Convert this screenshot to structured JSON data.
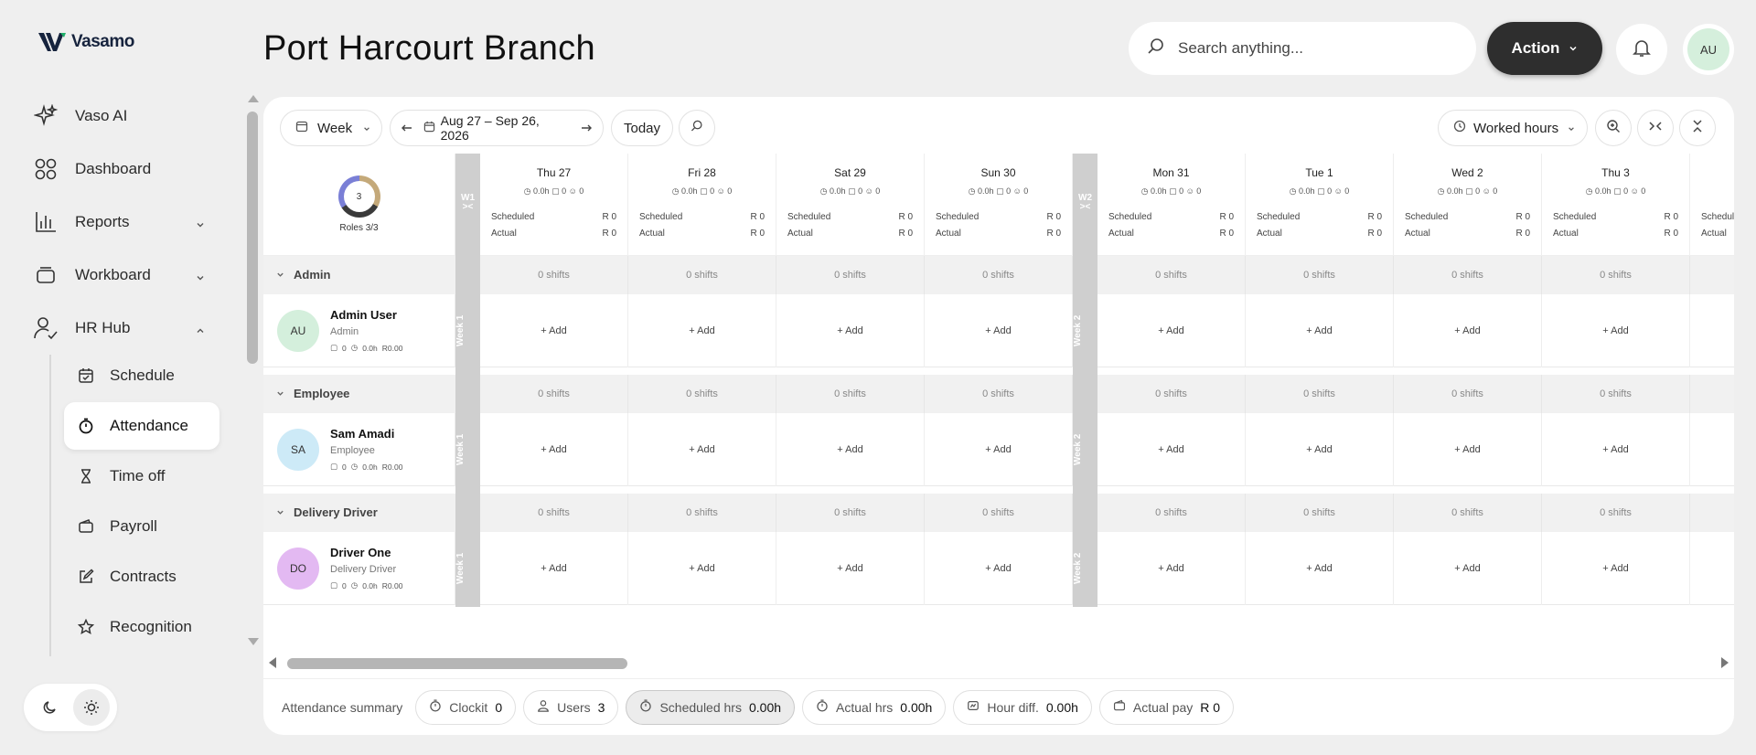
{
  "brand": {
    "name": "Vasamo"
  },
  "page": {
    "title": "Port Harcourt Branch"
  },
  "search": {
    "placeholder": "Search anything..."
  },
  "header": {
    "action_label": "Action",
    "avatar_initials": "AU"
  },
  "sidebar": {
    "items": [
      {
        "label": "Vaso AI",
        "icon": "sparkle-icon"
      },
      {
        "label": "Dashboard",
        "icon": "grid-icon"
      },
      {
        "label": "Reports",
        "icon": "bar-chart-icon",
        "expandable": true
      },
      {
        "label": "Workboard",
        "icon": "board-icon",
        "expandable": true
      },
      {
        "label": "HR Hub",
        "icon": "user-check-icon",
        "expanded": true
      }
    ],
    "subitems": [
      {
        "label": "Schedule",
        "icon": "calendar-check-icon"
      },
      {
        "label": "Attendance",
        "icon": "stopwatch-icon",
        "active": true
      },
      {
        "label": "Time off",
        "icon": "hourglass-icon"
      },
      {
        "label": "Payroll",
        "icon": "wallet-icon"
      },
      {
        "label": "Contracts",
        "icon": "edit-doc-icon"
      },
      {
        "label": "Recognition",
        "icon": "star-icon"
      }
    ]
  },
  "toolbar": {
    "view_label": "Week",
    "date_range": "Aug 27 – Sep 26, 2026",
    "today_label": "Today",
    "metric_label": "Worked hours"
  },
  "grid": {
    "roles_center": "3",
    "roles_label": "Roles 3/3",
    "week_labels": [
      "W1",
      "W2"
    ],
    "week_vertical": [
      "Week 1",
      "Week 2"
    ],
    "days": [
      {
        "name": "Thu 27",
        "hours": "0.0h",
        "shifts": "0",
        "users": "0",
        "scheduled": "R 0",
        "actual": "R 0"
      },
      {
        "name": "Fri 28",
        "hours": "0.0h",
        "shifts": "0",
        "users": "0",
        "scheduled": "R 0",
        "actual": "R 0"
      },
      {
        "name": "Sat 29",
        "hours": "0.0h",
        "shifts": "0",
        "users": "0",
        "scheduled": "R 0",
        "actual": "R 0"
      },
      {
        "name": "Sun 30",
        "hours": "0.0h",
        "shifts": "0",
        "users": "0",
        "scheduled": "R 0",
        "actual": "R 0"
      },
      {
        "name": "Mon 31",
        "hours": "0.0h",
        "shifts": "0",
        "users": "0",
        "scheduled": "R 0",
        "actual": "R 0"
      },
      {
        "name": "Tue 1",
        "hours": "0.0h",
        "shifts": "0",
        "users": "0",
        "scheduled": "R 0",
        "actual": "R 0"
      },
      {
        "name": "Wed 2",
        "hours": "0.0h",
        "shifts": "0",
        "users": "0",
        "scheduled": "R 0",
        "actual": "R 0"
      },
      {
        "name": "Thu 3",
        "hours": "0.0h",
        "shifts": "0",
        "users": "0",
        "scheduled": "R 0",
        "actual": "R 0"
      }
    ],
    "scheduled_label": "Scheduled",
    "actual_label": "Actual",
    "shifts_text": "0 shifts",
    "add_text": "+ Add",
    "groups": [
      {
        "name": "Admin",
        "employee": {
          "initials": "AU",
          "name": "Admin User",
          "role": "Admin",
          "shifts": "0",
          "hours": "0.0h",
          "pay": "R0.00",
          "color": "#d4efdc"
        }
      },
      {
        "name": "Employee",
        "employee": {
          "initials": "SA",
          "name": "Sam Amadi",
          "role": "Employee",
          "shifts": "0",
          "hours": "0.0h",
          "pay": "R0.00",
          "color": "#cdeaf7"
        }
      },
      {
        "name": "Delivery Driver",
        "employee": {
          "initials": "DO",
          "name": "Driver One",
          "role": "Delivery Driver",
          "shifts": "0",
          "hours": "0.0h",
          "pay": "R0.00",
          "color": "#e3b9f2"
        }
      }
    ]
  },
  "summary": {
    "label": "Attendance summary",
    "chips": [
      {
        "label": "Clockit",
        "value": "0"
      },
      {
        "label": "Users",
        "value": "3"
      },
      {
        "label": "Scheduled hrs",
        "value": "0.00h",
        "active": true
      },
      {
        "label": "Actual hrs",
        "value": "0.00h"
      },
      {
        "label": "Hour diff.",
        "value": "0.00h"
      },
      {
        "label": "Actual pay",
        "value": "R 0"
      }
    ]
  }
}
